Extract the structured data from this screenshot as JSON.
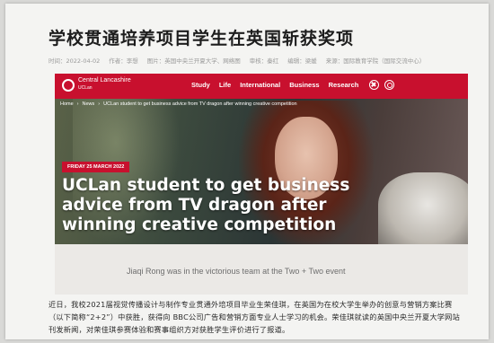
{
  "article": {
    "headline": "学校贯通培养项目学生在英国斩获奖项",
    "meta": [
      "时间：2022-04-02",
      "作者：李想",
      "图片：英国中央兰开夏大学、网络图",
      "审核：秦红",
      "编辑：梁媛",
      "来源：国际教育学院（国际交流中心）"
    ],
    "body": "近日，我校2021届视觉传播设计与制作专业贯通外培项目毕业生荣佳琪，在英国为在校大学生举办的创意与营销方案比赛（以下简称“2+2”）中获胜，获得向 BBC公司广告和营销方面专业人士学习的机会。荣佳琪就读的英国中央兰开夏大学网站刊发新闻，对荣佳琪参赛体验和赛事组织方对获胜学生评价进行了报道。"
  },
  "embedded": {
    "logo": {
      "name": "Central Lancashire",
      "sub": "UCLan"
    },
    "nav": [
      "Study",
      "Life",
      "International",
      "Business",
      "Research"
    ],
    "icons": [
      "close-icon",
      "search-icon"
    ],
    "breadcrumb": [
      "Home",
      "›",
      "News",
      "›",
      "UCLan student to get business advice from TV dragon after winning creative competition"
    ],
    "date_badge": "FRIDAY 25 MARCH 2022",
    "title": "UCLan student to get business advice from TV dragon after winning creative competition",
    "caption": "Jiaqi Rong was in the victorious team at the Two + Two event"
  },
  "colors": {
    "accent": "#c8102e"
  }
}
